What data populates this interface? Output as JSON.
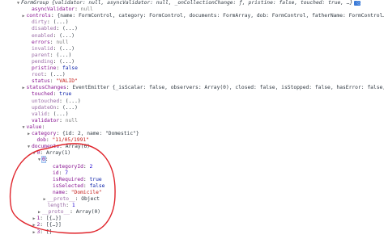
{
  "console": {
    "lines": [
      {
        "indent": 0,
        "tri": "down",
        "label": "FormGroup",
        "value": " {validator: null, asyncValidator: null, _onCollectionChange: ƒ, pristine: false, touched: true, …}",
        "label_class": "val-txt italic",
        "value_class": "val-txt italic",
        "info_icon": true
      },
      {
        "indent": 2,
        "key": "asyncValidator",
        "sep": ": ",
        "value": "null",
        "value_class": "val-null"
      },
      {
        "indent": 1,
        "tri": "right",
        "key": "controls",
        "sep": ": ",
        "value": "{name: FormControl, category: FormControl, documents: FormArray, dob: FormControl, fatherName: FormControl…",
        "value_class": "val-txt"
      },
      {
        "indent": 2,
        "key": "dirty",
        "sep": ": ",
        "value": "(...)",
        "value_class": "val-txt",
        "dim": true
      },
      {
        "indent": 2,
        "key": "disabled",
        "sep": ": ",
        "value": "(...)",
        "value_class": "val-txt",
        "dim": true
      },
      {
        "indent": 2,
        "key": "enabled",
        "sep": ": ",
        "value": "(...)",
        "value_class": "val-txt",
        "dim": true
      },
      {
        "indent": 2,
        "key": "errors",
        "sep": ": ",
        "value": "null",
        "value_class": "val-null"
      },
      {
        "indent": 2,
        "key": "invalid",
        "sep": ": ",
        "value": "(...)",
        "value_class": "val-txt",
        "dim": true
      },
      {
        "indent": 2,
        "key": "parent",
        "sep": ": ",
        "value": "(...)",
        "value_class": "val-txt",
        "dim": true
      },
      {
        "indent": 2,
        "key": "pending",
        "sep": ": ",
        "value": "(...)",
        "value_class": "val-txt",
        "dim": true
      },
      {
        "indent": 2,
        "key": "pristine",
        "sep": ": ",
        "value": "false",
        "value_class": "val-bool"
      },
      {
        "indent": 2,
        "key": "root",
        "sep": ": ",
        "value": "(...)",
        "value_class": "val-txt",
        "dim": true
      },
      {
        "indent": 2,
        "key": "status",
        "sep": ": ",
        "value": "\"VALID\"",
        "value_class": "val-str"
      },
      {
        "indent": 1,
        "tri": "right",
        "key": "statusChanges",
        "sep": ": ",
        "value": "EventEmitter {_isScalar: false, observers: Array(0), closed: false, isStopped: false, hasError: false,…",
        "value_class": "val-txt"
      },
      {
        "indent": 2,
        "key": "touched",
        "sep": ": ",
        "value": "true",
        "value_class": "val-bool"
      },
      {
        "indent": 2,
        "key": "untouched",
        "sep": ": ",
        "value": "(...)",
        "value_class": "val-txt",
        "dim": true
      },
      {
        "indent": 2,
        "key": "updateOn",
        "sep": ": ",
        "value": "(...)",
        "value_class": "val-txt",
        "dim": true
      },
      {
        "indent": 2,
        "key": "valid",
        "sep": ": ",
        "value": "(...)",
        "value_class": "val-txt",
        "dim": true
      },
      {
        "indent": 2,
        "key": "validator",
        "sep": ": ",
        "value": "null",
        "value_class": "val-null"
      },
      {
        "indent": 1,
        "tri": "down",
        "key": "value",
        "sep": ":",
        "value": "",
        "value_class": "val-txt"
      },
      {
        "indent": 2,
        "tri": "right",
        "key": "category",
        "sep": ": ",
        "value": "{id: 2, name: \"Domestic\"}",
        "value_class": "val-txt"
      },
      {
        "indent": 3,
        "key": "dob",
        "sep": ": ",
        "value": "\"11/05/1991\"",
        "value_class": "val-str"
      },
      {
        "indent": 2,
        "tri": "down",
        "key": "documents",
        "sep": ": ",
        "value": "Array(6)",
        "value_class": "val-txt"
      },
      {
        "indent": 3,
        "tri": "down",
        "key": "0",
        "sep": ": ",
        "value": "Array(1)",
        "value_class": "val-txt"
      },
      {
        "indent": 4,
        "tri": "down",
        "key": "0",
        "sep": ":",
        "value": "",
        "value_class": "val-txt",
        "highlight": true
      },
      {
        "indent": 6,
        "key": "categoryId",
        "sep": ": ",
        "value": "2",
        "value_class": "val-num"
      },
      {
        "indent": 6,
        "key": "id",
        "sep": ": ",
        "value": "7",
        "value_class": "val-num"
      },
      {
        "indent": 6,
        "key": "isRequired",
        "sep": ": ",
        "value": "true",
        "value_class": "val-bool"
      },
      {
        "indent": 6,
        "key": "isSelected",
        "sep": ": ",
        "value": "false",
        "value_class": "val-bool"
      },
      {
        "indent": 6,
        "key": "name",
        "sep": ": ",
        "value": "\"Domicile\"",
        "value_class": "val-str"
      },
      {
        "indent": 5,
        "tri": "right",
        "key": "__proto__",
        "sep": ": ",
        "value": "Object",
        "value_class": "val-txt",
        "dim": true
      },
      {
        "indent": 5,
        "key": "length",
        "sep": ": ",
        "value": "1",
        "value_class": "val-num",
        "dim": true
      },
      {
        "indent": 4,
        "tri": "right",
        "key": "__proto__",
        "sep": ": ",
        "value": "Array(0)",
        "value_class": "val-txt",
        "dim": true
      },
      {
        "indent": 3,
        "tri": "right",
        "key": "1",
        "sep": ": ",
        "value": "[{…}]",
        "value_class": "val-txt"
      },
      {
        "indent": 3,
        "tri": "right",
        "key": "2",
        "sep": ": ",
        "value": "[{…}]",
        "value_class": "val-txt"
      },
      {
        "indent": 3,
        "tri": "right",
        "key": "3",
        "sep": ": ",
        "value": "[]",
        "value_class": "val-txt"
      }
    ]
  },
  "annotation": {
    "stroke_color": "#e0242b"
  }
}
